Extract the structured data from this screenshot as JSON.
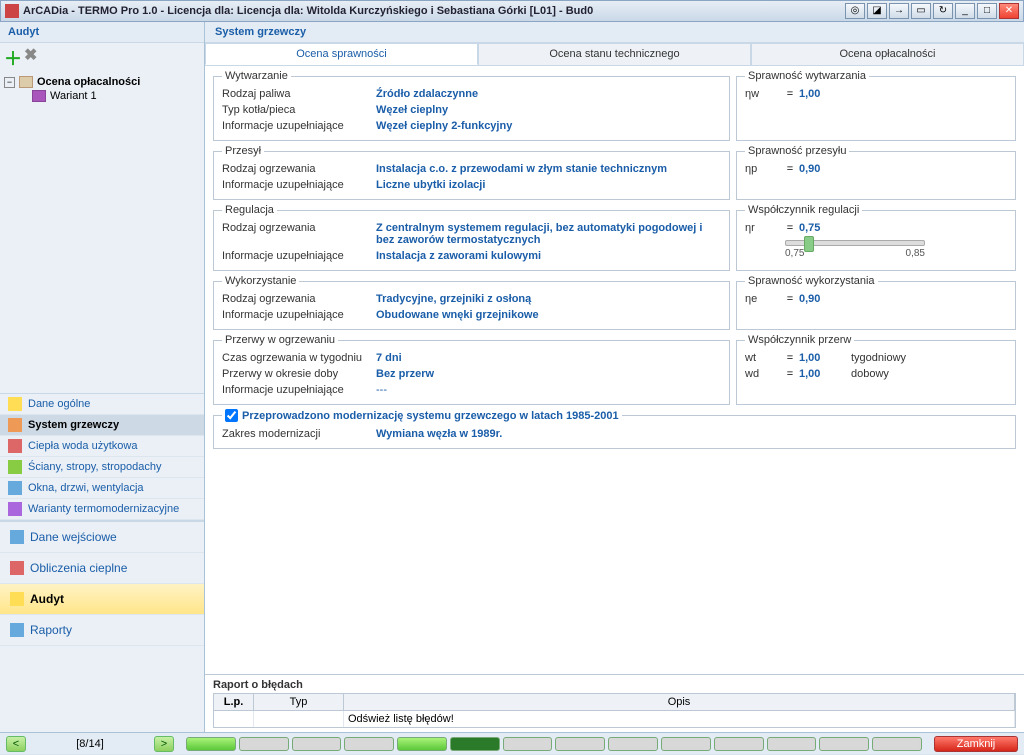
{
  "window": {
    "title": "ArCADia - TERMO Pro 1.0 - Licencja dla: Licencja dla: Witolda Kurczyńskiego i Sebastiana Górki [L01] - Bud0"
  },
  "left": {
    "header": "Audyt",
    "tree": {
      "root": "Ocena opłacalności",
      "child": "Wariant 1"
    },
    "nav": [
      "Dane ogólne",
      "System grzewczy",
      "Ciepła woda użytkowa",
      "Ściany, stropy, stropodachy",
      "Okna, drzwi, wentylacja",
      "Warianty termomodernizacyjne"
    ],
    "bignav": [
      "Dane wejściowe",
      "Obliczenia cieplne",
      "Audyt",
      "Raporty"
    ]
  },
  "right": {
    "header": "System grzewczy",
    "tabs": [
      "Ocena sprawności",
      "Ocena stanu technicznego",
      "Ocena opłacalności"
    ]
  },
  "sections": {
    "wytwarzanie": {
      "legend": "Wytwarzanie",
      "f1": {
        "l": "Rodzaj paliwa",
        "v": "Źródło zdalaczynne"
      },
      "f2": {
        "l": "Typ kotła/pieca",
        "v": "Węzeł cieplny"
      },
      "f3": {
        "l": "Informacje uzupełniające",
        "v": "Węzeł cieplny 2-funkcyjny"
      }
    },
    "przesyl": {
      "legend": "Przesył",
      "f1": {
        "l": "Rodzaj ogrzewania",
        "v": "Instalacja c.o. z przewodami w złym stanie technicznym"
      },
      "f2": {
        "l": "Informacje uzupełniające",
        "v": "Liczne ubytki izolacji"
      }
    },
    "regulacja": {
      "legend": "Regulacja",
      "f1": {
        "l": "Rodzaj ogrzewania",
        "v": "Z centralnym systemem regulacji, bez automatyki pogodowej i bez zaworów termostatycznych"
      },
      "f2": {
        "l": "Informacje uzupełniające",
        "v": "Instalacja z zaworami kulowymi"
      }
    },
    "wykorzystanie": {
      "legend": "Wykorzystanie",
      "f1": {
        "l": "Rodzaj ogrzewania",
        "v": "Tradycyjne, grzejniki z osłoną"
      },
      "f2": {
        "l": "Informacje uzupełniające",
        "v": "Obudowane wnęki grzejnikowe"
      }
    },
    "przerwy": {
      "legend": "Przerwy w ogrzewaniu",
      "f1": {
        "l": "Czas ogrzewania w tygodniu",
        "v": "7 dni"
      },
      "f2": {
        "l": "Przerwy w okresie doby",
        "v": "Bez przerw"
      },
      "f3": {
        "l": "Informacje uzupełniające",
        "v": "---"
      }
    },
    "modern": {
      "check_label": "Przeprowadzono modernizację systemu grzewczego w latach 1985-2001",
      "f1": {
        "l": "Zakres modernizacji",
        "v": "Wymiana węzła w 1989r."
      }
    }
  },
  "eff": {
    "wytw": {
      "legend": "Sprawność wytwarzania",
      "sym": "ηw",
      "val": "1,00"
    },
    "przes": {
      "legend": "Sprawność przesyłu",
      "sym": "ηp",
      "val": "0,90"
    },
    "reg": {
      "legend": "Współczynnik regulacji",
      "sym": "ηr",
      "val": "0,75",
      "tick1": "0,75",
      "tick2": "0,85"
    },
    "wyk": {
      "legend": "Sprawność wykorzystania",
      "sym": "ηe",
      "val": "0,90"
    },
    "przerw": {
      "legend": "Współczynnik przerw",
      "w1": {
        "sym": "wt",
        "val": "1,00",
        "desc": "tygodniowy"
      },
      "w2": {
        "sym": "wd",
        "val": "1,00",
        "desc": "dobowy"
      }
    }
  },
  "report": {
    "legend": "Raport o błędach",
    "cols": {
      "c1": "L.p.",
      "c2": "Typ",
      "c3": "Opis"
    },
    "row1": "Odśwież listę błędów!"
  },
  "bottom": {
    "page": "[8/14]",
    "close": "Zamknij"
  }
}
